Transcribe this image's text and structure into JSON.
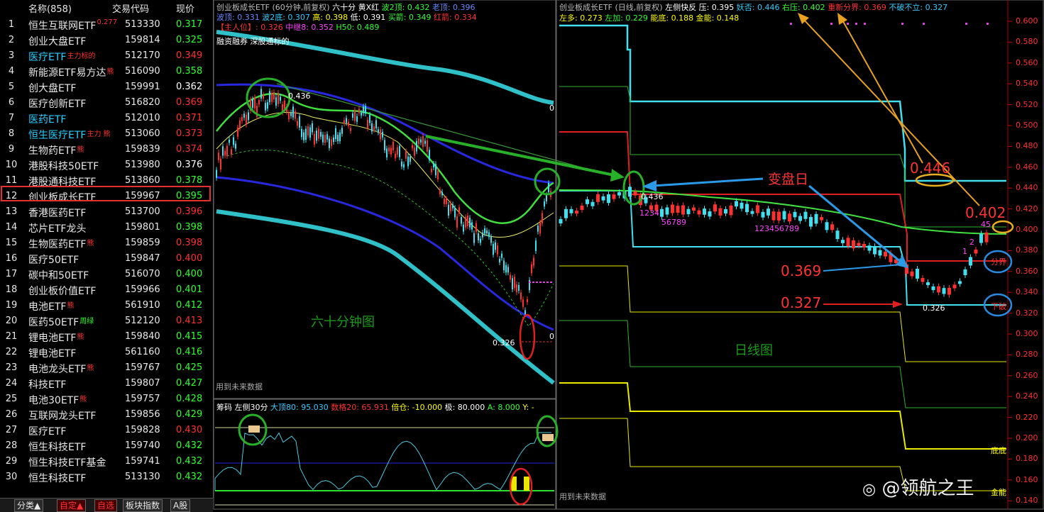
{
  "list": {
    "header": {
      "name_col": "名称(858)",
      "code_col": "交易代码",
      "price_col": "现价"
    },
    "rows": [
      {
        "idx": "1",
        "name": "恒生互联网ETF",
        "tag": "0.277",
        "code": "513330",
        "price": "0.317",
        "pc": "g"
      },
      {
        "idx": "2",
        "name": "创业大盘ETF",
        "tag": "",
        "code": "159814",
        "price": "0.325",
        "pc": "g"
      },
      {
        "idx": "3",
        "name": "医疗ETF",
        "tag": "主力标的",
        "code": "512170",
        "price": "0.349",
        "pc": "r",
        "cy": true
      },
      {
        "idx": "4",
        "name": "新能源ETF易方达",
        "tag": "熊",
        "code": "516090",
        "price": "0.358",
        "pc": "g"
      },
      {
        "idx": "5",
        "name": "创大盘ETF",
        "tag": "",
        "code": "159991",
        "price": "0.362",
        "pc": "w"
      },
      {
        "idx": "6",
        "name": "医疗创新ETF",
        "tag": "",
        "code": "516820",
        "price": "0.369",
        "pc": "r"
      },
      {
        "idx": "7",
        "name": "医药ETF",
        "tag": "",
        "code": "512010",
        "price": "0.371",
        "pc": "r",
        "cy": true
      },
      {
        "idx": "8",
        "name": "恒生医疗ETF",
        "tag": "主力 熊",
        "code": "513060",
        "price": "0.373",
        "pc": "r",
        "cy": true
      },
      {
        "idx": "9",
        "name": "生物药ETF",
        "tag": "熊",
        "code": "159839",
        "price": "0.374",
        "pc": "r"
      },
      {
        "idx": "10",
        "name": "港股科技50ETF",
        "tag": "",
        "code": "513980",
        "price": "0.376",
        "pc": "w"
      },
      {
        "idx": "11",
        "name": "港股通科技ETF",
        "tag": "",
        "code": "513860",
        "price": "0.378",
        "pc": "g"
      },
      {
        "idx": "12",
        "name": "创业板成长ETF",
        "tag": "",
        "code": "159967",
        "price": "0.395",
        "pc": "g"
      },
      {
        "idx": "13",
        "name": "香港医药ETF",
        "tag": "",
        "code": "513700",
        "price": "0.396",
        "pc": "r"
      },
      {
        "idx": "14",
        "name": "芯片ETF龙头",
        "tag": "",
        "code": "159801",
        "price": "0.398",
        "pc": "g"
      },
      {
        "idx": "15",
        "name": "生物医药ETF",
        "tag": "熊",
        "code": "159859",
        "price": "0.398",
        "pc": "r"
      },
      {
        "idx": "16",
        "name": "医疗50ETF",
        "tag": "",
        "code": "159847",
        "price": "0.400",
        "pc": "r"
      },
      {
        "idx": "17",
        "name": "碳中和50ETF",
        "tag": "",
        "code": "516070",
        "price": "0.400",
        "pc": "g"
      },
      {
        "idx": "18",
        "name": "创业板价值ETF",
        "tag": "",
        "code": "159966",
        "price": "0.401",
        "pc": "g"
      },
      {
        "idx": "19",
        "name": "电池ETF",
        "tag": "熊",
        "code": "561910",
        "price": "0.412",
        "pc": "g"
      },
      {
        "idx": "20",
        "name": "医药50ETF",
        "tag": "周绿",
        "code": "512120",
        "price": "0.413",
        "pc": "r",
        "tagc": "g"
      },
      {
        "idx": "21",
        "name": "锂电池ETF",
        "tag": "熊",
        "code": "159840",
        "price": "0.415",
        "pc": "g"
      },
      {
        "idx": "22",
        "name": "锂电池ETF",
        "tag": "",
        "code": "561160",
        "price": "0.416",
        "pc": "g"
      },
      {
        "idx": "23",
        "name": "电池龙头ETF",
        "tag": "熊",
        "code": "159767",
        "price": "0.425",
        "pc": "g"
      },
      {
        "idx": "24",
        "name": "科技ETF",
        "tag": "",
        "code": "159807",
        "price": "0.427",
        "pc": "g"
      },
      {
        "idx": "25",
        "name": "电池30ETF",
        "tag": "熊",
        "code": "159757",
        "price": "0.428",
        "pc": "g"
      },
      {
        "idx": "26",
        "name": "互联网龙头ETF",
        "tag": "",
        "code": "159856",
        "price": "0.429",
        "pc": "g"
      },
      {
        "idx": "27",
        "name": "医疗ETF",
        "tag": "",
        "code": "159828",
        "price": "0.430",
        "pc": "r"
      },
      {
        "idx": "28",
        "name": "恒生科技ETF",
        "tag": "",
        "code": "159740",
        "price": "0.432",
        "pc": "g"
      },
      {
        "idx": "29",
        "name": "恒生科技ETF基金",
        "tag": "",
        "code": "159741",
        "price": "0.432",
        "pc": "g"
      },
      {
        "idx": "30",
        "name": "恒生科技ETF",
        "tag": "",
        "code": "513130",
        "price": "0.432",
        "pc": "g"
      }
    ],
    "tabs": [
      "分类▲",
      "自定▲",
      "自选",
      "板块指数",
      "A股"
    ]
  },
  "hour_panel": {
    "title": "创业板成长ETF (60分钟,前复权)",
    "ind_name": "六十分 黄X红",
    "wave2_top": "波2顶: 0.432",
    "old_top": "老顶: 0.396",
    "wave_top": "波顶: 0.331",
    "wave2_bottom": "波2底: 0.307",
    "high": "高: 0.398",
    "low": "低: 0.391",
    "buy_arrow": "买箭: 0.349",
    "red_arrow": "红箭: 0.334",
    "main_pos": "【主人位】: 0.326",
    "relay8": "中继8: 0.352",
    "h50": "H50: 0.489",
    "sub_title": "融资融券 深股通标的",
    "high_label": "0.436",
    "low_label": "0.326",
    "zero1": "0",
    "zero2": "0",
    "watermark": "六十分钟图",
    "future_note": "用到未来数据"
  },
  "chip_panel": {
    "name": "筹码 左侧30分",
    "top80": "大顶80: 95.030",
    "num20": "数格20: 65.931",
    "pos": "倍仓: -10.000",
    "ext": "极: 80.000",
    "a": "A: 8.000",
    "y": "Y: -"
  },
  "day_panel": {
    "title": "创业板成长ETF (日线,前复权)",
    "ind_name": "左侧快反",
    "press": "压: 0.395",
    "demon": "妖否: 0.446",
    "right_press": "右压: 0.402",
    "re_split": "重新分界: 0.369",
    "not_break": "不破不立: 0.327",
    "left_many": "左多: 0.273",
    "left_add": "左加: 0.229",
    "energy_bottom": "能底: 0.188",
    "gold_energy": "金能: 0.148",
    "high_label": "0.436",
    "low_label": "0.326",
    "turn_day": "变盘日",
    "v446": "0.446",
    "v402": "0.402",
    "v369": "0.369",
    "v327": "0.327",
    "split_tag": "分界",
    "break_tag": "下破",
    "bottom_tag": "底底",
    "gold_tag": "金能",
    "seq1": "1234",
    "seq2": "56789",
    "seq3": "123456789",
    "seq4": "45",
    "seq5": "2",
    "seq6": "1",
    "watermark": "日线图",
    "future_note": "用到未来数据"
  },
  "axis": [
    "0.600",
    "0.580",
    "0.560",
    "0.540",
    "0.520",
    "0.500",
    "0.480",
    "0.460",
    "0.440",
    "0.420",
    "0.400",
    "0.380",
    "0.360",
    "0.340",
    "0.320",
    "0.300",
    "0.280",
    "0.260",
    "0.240",
    "0.220",
    "0.200",
    "0.180",
    "0.160",
    "0.140"
  ],
  "weibo": "@领航之王"
}
